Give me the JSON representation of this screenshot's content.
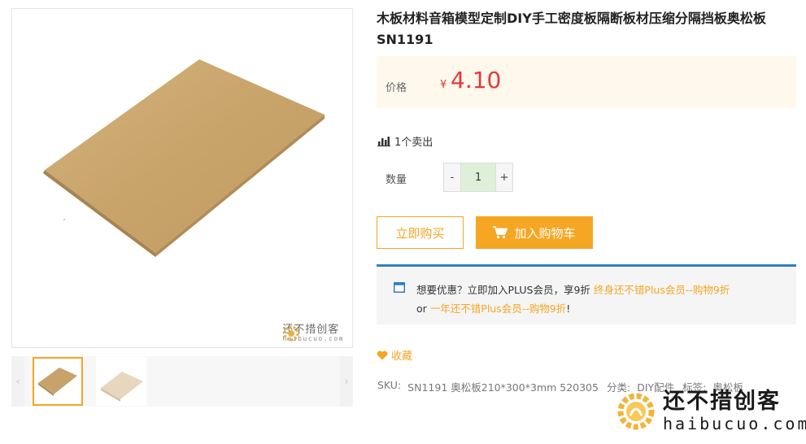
{
  "product": {
    "title": "木板材料音箱模型定制DIY手工密度板隔断板材压缩分隔挡板奥松板SN1191",
    "price_label": "价格",
    "currency": "¥",
    "price": "4.10",
    "sold": "1个卖出",
    "quantity_label": "数量",
    "quantity_value": "1",
    "minus": "-",
    "plus": "+"
  },
  "actions": {
    "buy_now": "立即购买",
    "add_to_cart": "加入购物车",
    "favorite": "收藏"
  },
  "promo": {
    "text": "想要优惠？立即加入PLUS会员，享9折",
    "link1": "终身还不错Plus会员--购物9折",
    "or": "or",
    "link2": "一年还不错Plus会员--购物9折",
    "tail": "!"
  },
  "meta": {
    "sku_label": "SKU:",
    "sku_value": "SN1191 奥松板210*300*3mm 520305",
    "category_label": "分类:",
    "category_value": "DIY配件",
    "tag_label": "标签:",
    "tag_value": "奥松板"
  },
  "gallery": {
    "prev": "‹",
    "next": "›"
  },
  "watermark": {
    "cn": "还不措创客",
    "en": "haibucuo.com"
  },
  "colors": {
    "accent": "#f5a623",
    "price": "#e4393c",
    "promo_border": "#2f7fc1",
    "board": "#c9a46a"
  }
}
